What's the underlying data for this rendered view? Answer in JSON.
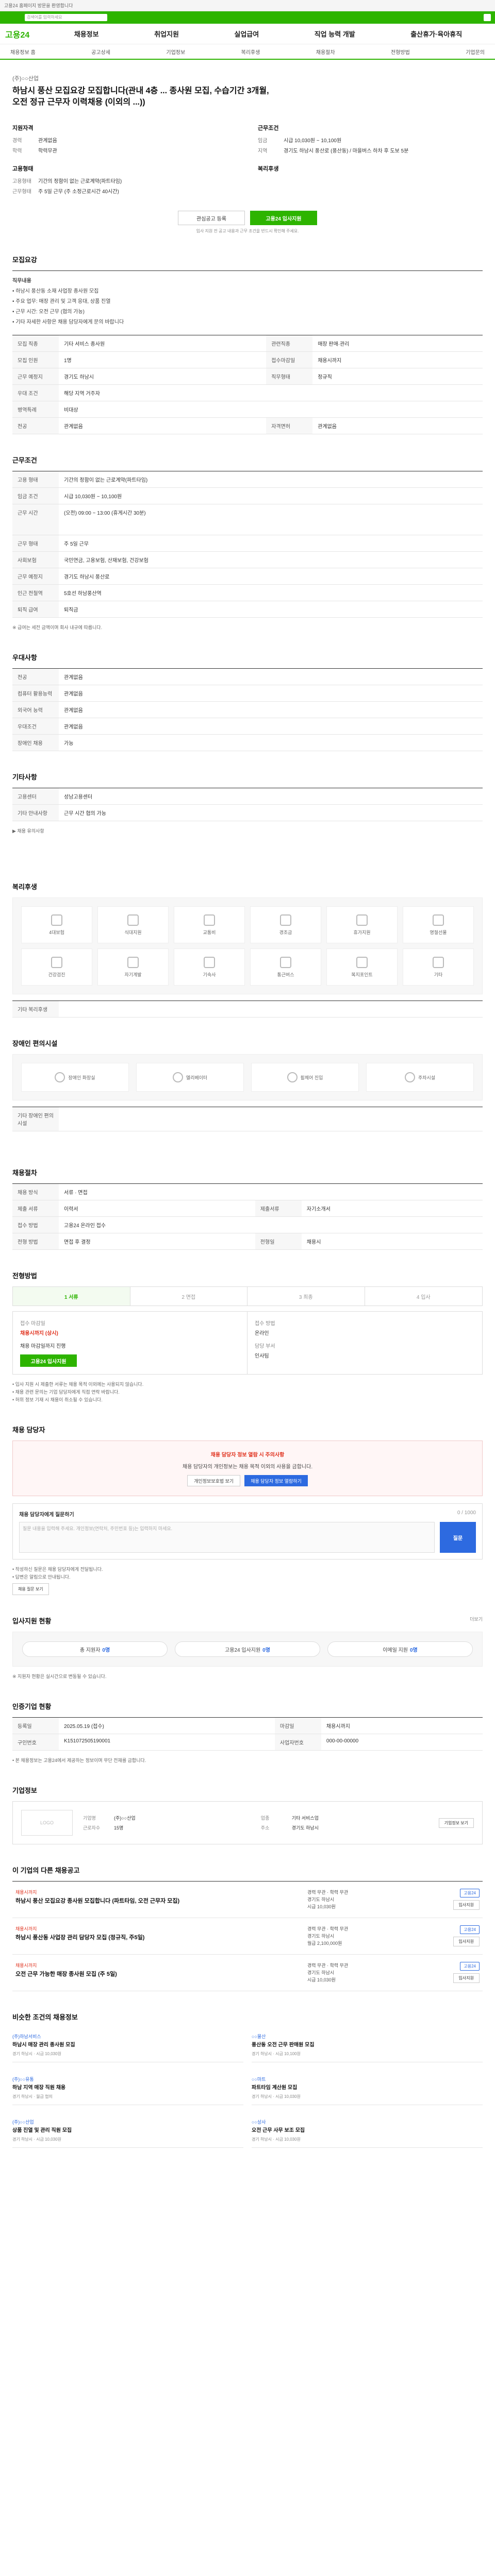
{
  "topbar": {
    "text": "고용24 홈페이지 방문을 환영합니다"
  },
  "header": {
    "search_placeholder": "검색어를 입력하세요",
    "logo": "고용24",
    "gnb": [
      "채용정보",
      "취업지원",
      "실업급여",
      "직업 능력 개발",
      "출산휴가·육아휴직"
    ]
  },
  "lnb": [
    "채용정보 홈",
    "공고상세",
    "기업정보",
    "복리후생",
    "채용절차",
    "전형방법",
    "기업문의"
  ],
  "job": {
    "company": "(주)○○산업",
    "title": "하남시 풍산 모집요강 모집합니다(관내 4층 ... 종사원 모집, 수습기간 3개월, 오전 정규 근무자 이력채용 (이외의 ...))",
    "summary_left_title": "지원자격",
    "summary_left": [
      {
        "k": "경력",
        "v": "관계없음"
      },
      {
        "k": "학력",
        "v": "학력무관"
      }
    ],
    "summary_left2_title": "고용형태",
    "summary_left2": [
      {
        "k": "고용형태",
        "v": "기간의 정함이 없는 근로계약(파트타임)"
      },
      {
        "k": "근무형태",
        "v": "주 5일 근무 (주 소정근로시간 40시간)"
      }
    ],
    "summary_right_title": "근무조건",
    "summary_right": [
      {
        "k": "임금",
        "v": "시급 10,030원 ~ 10,100원"
      },
      {
        "k": "지역",
        "v": "경기도 하남시 풍산로 (풍산동) / 마을버스 하차 후 도보 5분"
      }
    ],
    "summary_right2_title": "복리후생",
    "btn_save": "관심공고 등록",
    "btn_apply": "고용24 입사지원",
    "hint": "입사 지원 전 공고 내용과 근무 조건을 반드시 확인해 주세요."
  },
  "recruit": {
    "title": "모집요강",
    "desc_title": "직무내용",
    "desc": [
      "• 하남시 풍산동 소재 사업장 종사원 모집",
      "• 주요 업무: 매장 관리 및 고객 응대, 상품 진열",
      "• 근무 시간: 오전 근무 (협의 가능)",
      "• 기타 자세한 사항은 채용 담당자에게 문의 바랍니다"
    ],
    "rows": [
      {
        "k": "모집 직종",
        "v": "기타 서비스 종사원",
        "k2": "관련직종",
        "v2": "매장 판매·관리"
      },
      {
        "k": "모집 인원",
        "v": "1명",
        "k2": "접수마감일",
        "v2": "채용시까지"
      },
      {
        "k": "근무 예정지",
        "v": "경기도 하남시",
        "k2": "직무형태",
        "v2": "정규직"
      },
      {
        "k": "우대 조건",
        "v": "해당 지역 거주자",
        "k2": "",
        "v2": ""
      },
      {
        "k": "병역특례",
        "v": "비대상",
        "k2": "",
        "v2": ""
      },
      {
        "k": "전공",
        "v": "관계없음",
        "k2": "자격면허",
        "v2": "관계없음"
      }
    ]
  },
  "conditions": {
    "title": "근무조건",
    "rows": [
      {
        "k": "고용 형태",
        "v": "기간의 정함이 없는 근로계약(파트타임)"
      },
      {
        "k": "임금 조건",
        "v": "시급 10,030원 ~ 10,100원"
      },
      {
        "k": "근무 시간",
        "v": "(오전) 09:00 ~ 13:00 (휴게시간 30분)"
      },
      {
        "k": "근무 형태",
        "v": "주 5일 근무"
      },
      {
        "k": "사회보험",
        "v": "국민연금, 고용보험, 산재보험, 건강보험"
      },
      {
        "k": "근무 예정지",
        "v": "경기도 하남시 풍산로"
      },
      {
        "k": "인근 전철역",
        "v": "5호선 하남풍산역"
      },
      {
        "k": "퇴직 급여",
        "v": "퇴직금"
      }
    ],
    "note": "※ 급여는 세전 금액이며 회사 내규에 따릅니다."
  },
  "apply_doc": {
    "title": "우대사항",
    "rows": [
      {
        "k": "전공",
        "v": "관계없음"
      },
      {
        "k": "컴퓨터 활용능력",
        "v": "관계없음"
      },
      {
        "k": "외국어 능력",
        "v": "관계없음"
      },
      {
        "k": "우대조건",
        "v": "관계없음"
      },
      {
        "k": "장애인 채용",
        "v": "가능"
      }
    ]
  },
  "etc": {
    "title": "기타사항",
    "rows": [
      {
        "k": "고용센터",
        "v": "성남고용센터"
      },
      {
        "k": "기타 안내사항",
        "v": "근무 시간 협의 가능"
      }
    ],
    "link": "▶ 채용 유의사항"
  },
  "welfare": {
    "title": "복리후생",
    "items": [
      "4대보험",
      "식대지원",
      "교통비",
      "경조금",
      "휴가지원",
      "명절선물",
      "건강검진",
      "자기계발",
      "기숙사",
      "통근버스",
      "복지포인트",
      "기타"
    ],
    "etc": "기타 복리후생"
  },
  "facility": {
    "title": "장애인 편의시설",
    "items": [
      "장애인 화장실",
      "엘리베이터",
      "휠체어 진입",
      "주차시설"
    ],
    "note": "기타 장애인 편의시설"
  },
  "process": {
    "title": "채용절차",
    "rows": [
      {
        "k": "채용 방식",
        "v": "서류 · 면접"
      },
      {
        "k": "제출 서류",
        "v": "이력서",
        "k2": "제출서류",
        "v2": "자기소개서"
      },
      {
        "k": "접수 방법",
        "v": "고용24 온라인 접수",
        "k2": "",
        "v2": ""
      },
      {
        "k": "전형 방법",
        "v": "면접 후 결정",
        "k2": "전형일",
        "v2": "채용시"
      }
    ]
  },
  "steps": {
    "title": "전형방법",
    "items": [
      "1 서류",
      "2 면접",
      "3 최종",
      "4 입사"
    ],
    "apply_left_lbl": "접수 마감일",
    "apply_left_val": "채용시까지 (상시)",
    "apply_left_red": "채용 마감일까지 진행",
    "apply_right_lbl": "접수 방법",
    "apply_right_val": "온라인",
    "apply_right_lbl2": "담당 부서",
    "apply_right_val2": "인사팀",
    "btn": "고용24 입사지원",
    "notes": [
      "• 입사 지원 시 제출한 서류는 채용 목적 이외에는 사용되지 않습니다.",
      "• 채용 관련 문의는 기업 담당자에게 직접 연락 바랍니다.",
      "• 허위 정보 기재 시 채용이 취소될 수 있습니다."
    ]
  },
  "contact": {
    "title": "채용 담당자",
    "notice_title": "채용 담당자 정보 열람 시 주의사항",
    "notice_text": "채용 담당자의 개인정보는 채용 목적 이외의 사용을 금합니다.",
    "btn1": "개인정보보호법 보기",
    "btn2": "채용 담당자 정보 열람하기",
    "qna_title": "채용 담당자에게 질문하기",
    "qna_count": "0 / 1000",
    "qna_placeholder": "질문 내용을 입력해 주세요. 개인정보(연락처, 주민번호 등)는 입력하지 마세요.",
    "qna_btn": "질문",
    "qna_notes": [
      "• 작성하신 질문은 채용 담당자에게 전달됩니다.",
      "• 답변은 알림으로 안내됩니다."
    ],
    "qna_link": "채용 질문 보기"
  },
  "stats": {
    "title": "입사지원 현황",
    "more": "더보기",
    "items": [
      {
        "label": "총 지원자",
        "value": "0명"
      },
      {
        "label": "고용24 입사지원",
        "value": "0명"
      },
      {
        "label": "이메일 지원",
        "value": "0명"
      }
    ],
    "note": "※ 지원자 현황은 실시간으로 변동될 수 있습니다."
  },
  "meta": {
    "title": "인증기업 현황",
    "rows": [
      {
        "k": "등록일",
        "v": "2025.05.19 (접수)",
        "k2": "마감일",
        "v2": "채용시까지"
      },
      {
        "k": "구인번호",
        "v": "K151072505190001",
        "k2": "사업자번호",
        "v2": "000-00-00000"
      }
    ],
    "notes": [
      "• 본 채용정보는 고용24에서 제공하는 정보이며 무단 전재를 금합니다."
    ]
  },
  "company_info": {
    "title": "기업정보",
    "logo": "LOGO",
    "rows": [
      {
        "k": "기업명",
        "v": "(주)○○산업"
      },
      {
        "k": "업종",
        "v": "기타 서비스업"
      },
      {
        "k": "근로자수",
        "v": "15명"
      },
      {
        "k": "주소",
        "v": "경기도 하남시"
      }
    ],
    "btn": "기업정보 보기"
  },
  "other_jobs": {
    "title": "이 기업의 다른 채용공고",
    "items": [
      {
        "co": "채용시까지",
        "title": "하남시 풍산 모집요강 종사원 모집합니다 (파트타임, 오전 근무자 모집)",
        "mid": [
          "경력 무관 · 학력 무관",
          "경기도 하남시",
          "시급 10,030원"
        ],
        "tag": "고용24",
        "btn": "입사지원"
      },
      {
        "co": "채용시까지",
        "title": "하남시 풍산동 사업장 관리 담당자 모집 (정규직, 주5일)",
        "mid": [
          "경력 무관 · 학력 무관",
          "경기도 하남시",
          "월급 2,100,000원"
        ],
        "tag": "고용24",
        "btn": "입사지원"
      },
      {
        "co": "채용시까지",
        "title": "오전 근무 가능한 매장 종사원 모집 (주 5일)",
        "mid": [
          "경력 무관 · 학력 무관",
          "경기도 하남시",
          "시급 10,030원"
        ],
        "tag": "고용24",
        "btn": "입사지원"
      }
    ]
  },
  "related": {
    "title": "비슷한 조건의 채용정보",
    "items": [
      {
        "co": "(주)하남서비스",
        "title": "하남시 매장 관리 종사원 모집",
        "meta": "경기 하남시 · 시급 10,030원"
      },
      {
        "co": "○○물산",
        "title": "풍산동 오전 근무 판매원 모집",
        "meta": "경기 하남시 · 시급 10,100원"
      },
      {
        "co": "(주)○○유통",
        "title": "하남 지역 매장 직원 채용",
        "meta": "경기 하남시 · 월급 협의"
      },
      {
        "co": "○○마트",
        "title": "파트타임 계산원 모집",
        "meta": "경기 하남시 · 시급 10,030원"
      },
      {
        "co": "(주)○○산업",
        "title": "상품 진열 및 관리 직원 모집",
        "meta": "경기 하남시 · 시급 10,030원"
      },
      {
        "co": "○○상사",
        "title": "오전 근무 사무 보조 모집",
        "meta": "경기 하남시 · 시급 10,030원"
      }
    ]
  }
}
